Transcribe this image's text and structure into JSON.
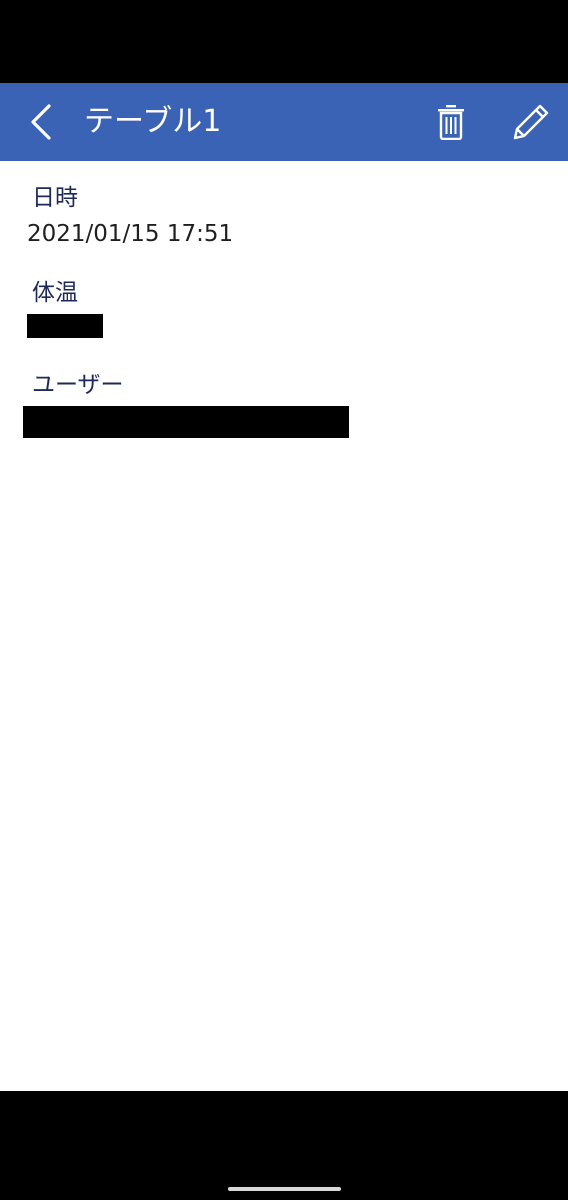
{
  "header": {
    "title": "テーブル1",
    "background_color": "#3b63b5",
    "icons": {
      "back": "chevron-left-icon",
      "delete": "trash-icon",
      "edit": "pencil-icon"
    }
  },
  "fields": {
    "datetime": {
      "label": "日時",
      "value": "2021/01/15 17:51"
    },
    "temperature": {
      "label": "体温",
      "value_redacted": true
    },
    "user": {
      "label": "ユーザー",
      "value_redacted": true
    }
  },
  "colors": {
    "label_text": "#1d2a57",
    "value_text": "#1f1f1f",
    "content_background": "#ffffff"
  }
}
